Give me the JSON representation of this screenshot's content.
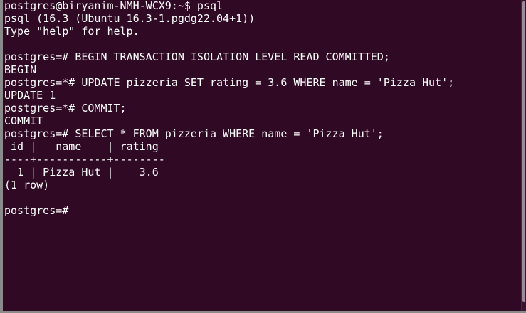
{
  "terminal": {
    "lines": [
      "postgres@biryanim-NMH-WCX9:~$ psql",
      "psql (16.3 (Ubuntu 16.3-1.pgdg22.04+1))",
      "Type \"help\" for help.",
      "",
      "postgres=# BEGIN TRANSACTION ISOLATION LEVEL READ COMMITTED;",
      "BEGIN",
      "postgres=*# UPDATE pizzeria SET rating = 3.6 WHERE name = 'Pizza Hut';",
      "UPDATE 1",
      "postgres=*# COMMIT;",
      "COMMIT",
      "postgres=# SELECT * FROM pizzeria WHERE name = 'Pizza Hut';",
      " id |   name    | rating",
      "----+-----------+--------",
      "  1 | Pizza Hut |    3.6",
      "(1 row)",
      "",
      "postgres=# "
    ]
  },
  "colors": {
    "background": "#300a24",
    "text": "#ffffff"
  }
}
